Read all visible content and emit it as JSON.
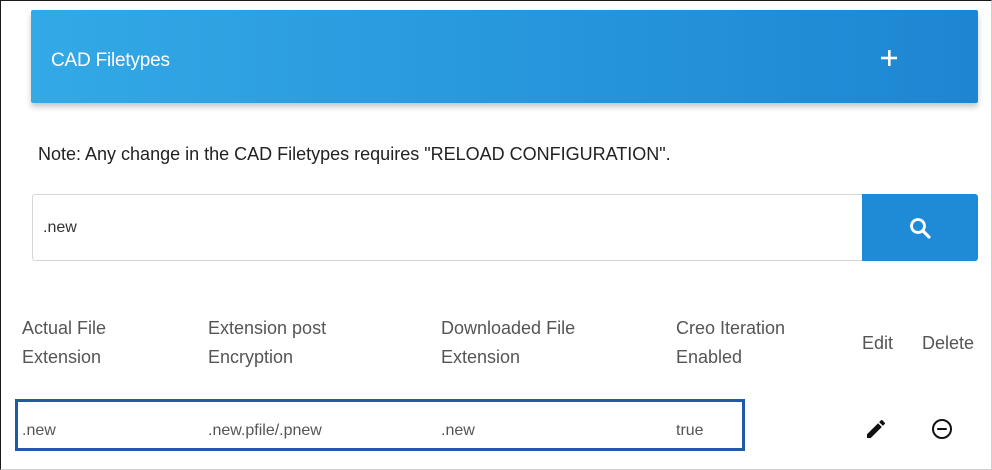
{
  "header": {
    "title": "CAD Filetypes",
    "add_icon": "plus-icon"
  },
  "note": "Note: Any change in the CAD Filetypes requires \"RELOAD CONFIGURATION\".",
  "search": {
    "value": ".new",
    "icon": "search-icon"
  },
  "table": {
    "columns": [
      {
        "line1": "Actual File",
        "line2": "Extension"
      },
      {
        "line1": "Extension post",
        "line2": "Encryption"
      },
      {
        "line1": "Downloaded File",
        "line2": "Extension"
      },
      {
        "line1": "Creo Iteration",
        "line2": "Enabled"
      },
      {
        "line1": "Edit",
        "line2": ""
      },
      {
        "line1": "Delete",
        "line2": ""
      }
    ],
    "rows": [
      {
        "actual_ext": ".new",
        "encrypted_ext": ".new.pfile/.pnew",
        "downloaded_ext": ".new",
        "creo_iteration": "true",
        "edit_icon": "pencil-icon",
        "delete_icon": "minus-circle-icon"
      }
    ]
  },
  "colors": {
    "header_start": "#33a9e6",
    "header_end": "#1d86d3",
    "search_button": "#1f8bd6",
    "row_highlight_border": "#1f5aa6"
  }
}
